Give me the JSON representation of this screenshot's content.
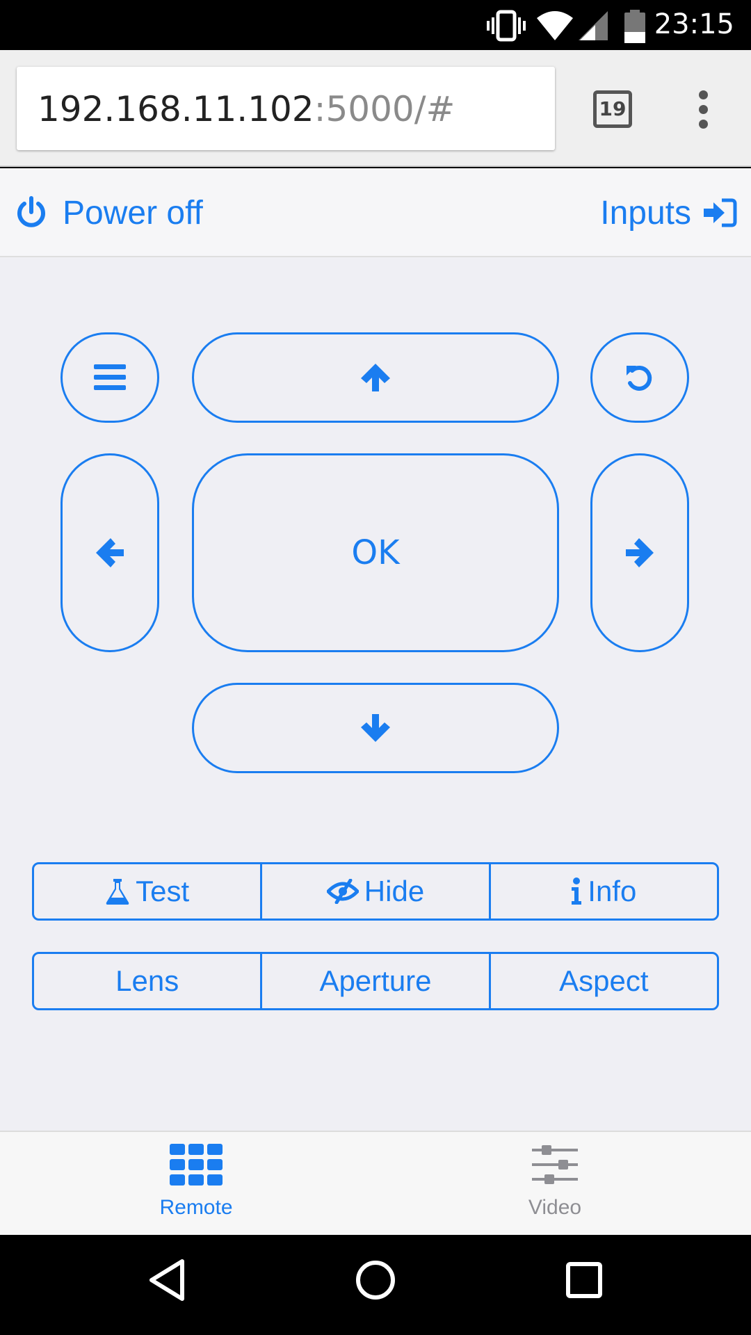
{
  "status_bar": {
    "time": "23:15",
    "icons": [
      "vibrate-icon",
      "wifi-icon",
      "cell-signal-icon",
      "battery-icon"
    ]
  },
  "browser": {
    "url_host": "192.168.11.102",
    "url_rest": ":5000/#",
    "tab_count": "19",
    "menu_icon": "more-vert-icon"
  },
  "header": {
    "power_label": "Power off",
    "power_icon": "power-icon",
    "inputs_label": "Inputs",
    "inputs_icon": "sign-in-icon"
  },
  "remote": {
    "ok_label": "OK",
    "menu_icon": "hamburger-icon",
    "up_icon": "arrow-up-icon",
    "back_icon": "undo-icon",
    "left_icon": "arrow-left-icon",
    "right_icon": "arrow-right-icon",
    "down_icon": "arrow-down-icon"
  },
  "actions_row1": [
    {
      "label": "Test",
      "icon": "flask-icon"
    },
    {
      "label": "Hide",
      "icon": "eye-slash-icon"
    },
    {
      "label": "Info",
      "icon": "info-icon"
    }
  ],
  "actions_row2": [
    {
      "label": "Lens"
    },
    {
      "label": "Aperture"
    },
    {
      "label": "Aspect"
    }
  ],
  "tabs": [
    {
      "label": "Remote",
      "icon": "grid-icon",
      "active": true
    },
    {
      "label": "Video",
      "icon": "sliders-icon",
      "active": false
    }
  ],
  "colors": {
    "accent": "#1a7df0",
    "inactive": "#8e8e93",
    "background": "#efeff4"
  },
  "nav_bar": {
    "icons": [
      "back-triangle-icon",
      "home-circle-icon",
      "recents-square-icon"
    ]
  }
}
